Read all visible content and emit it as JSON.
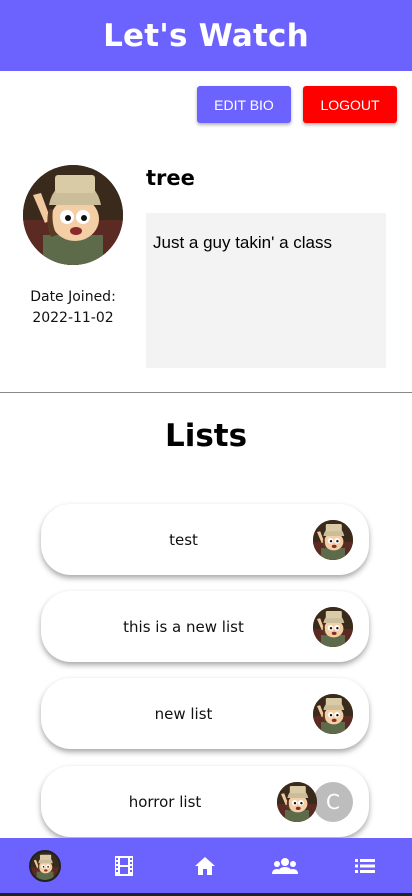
{
  "header": {
    "title": "Let's Watch"
  },
  "actions": {
    "edit_bio_label": "EDIT BIO",
    "logout_label": "LOGOUT"
  },
  "profile": {
    "username": "tree",
    "bio": "Just a guy takin' a class",
    "date_joined_label": "Date Joined:",
    "date_joined": "2022-11-02",
    "avatar_icon": "cartoon-character-avatar"
  },
  "lists_section": {
    "title": "Lists",
    "items": [
      {
        "name": "test",
        "members": [
          "avatar"
        ]
      },
      {
        "name": "this is a new list",
        "members": [
          "avatar"
        ]
      },
      {
        "name": "new list",
        "members": [
          "avatar"
        ]
      },
      {
        "name": "horror list",
        "members": [
          "avatar",
          "C"
        ]
      }
    ]
  },
  "bottom_nav": {
    "items": [
      "profile-avatar",
      "film-icon",
      "home-icon",
      "group-icon",
      "list-icon"
    ]
  },
  "colors": {
    "primary": "#6c63ff",
    "logout": "#ff0000",
    "bio_bg": "#f3f3f3",
    "letter_avatar": "#bdbdbd"
  }
}
